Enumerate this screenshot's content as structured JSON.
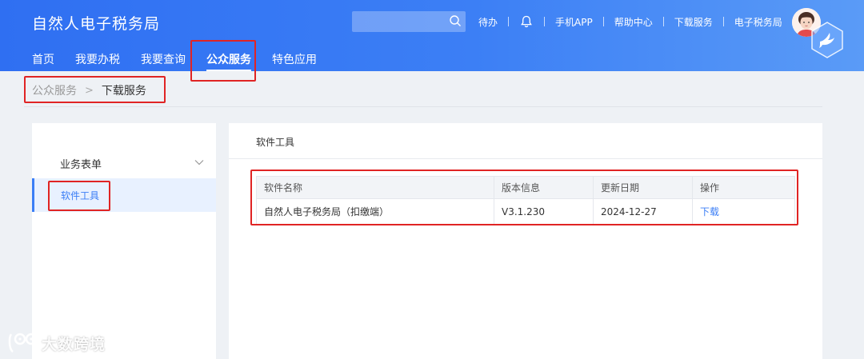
{
  "header": {
    "app_title": "自然人电子税务局",
    "search": {
      "placeholder": ""
    },
    "links": [
      "待办",
      "手机APP",
      "帮助中心",
      "下载服务",
      "电子税务局"
    ]
  },
  "nav": {
    "tabs": [
      {
        "label": "首页",
        "active": false
      },
      {
        "label": "我要办税",
        "active": false
      },
      {
        "label": "我要查询",
        "active": false
      },
      {
        "label": "公众服务",
        "active": true
      },
      {
        "label": "特色应用",
        "active": false
      }
    ]
  },
  "breadcrumb": {
    "parent": "公众服务",
    "separator": ">",
    "current": "下载服务"
  },
  "sidebar": {
    "group_label": "业务表单",
    "selected_item": "软件工具"
  },
  "main": {
    "section_title": "软件工具",
    "table": {
      "headers": [
        "软件名称",
        "版本信息",
        "更新日期",
        "操作"
      ],
      "rows": [
        {
          "name": "自然人电子税务局（扣缴端）",
          "version": "V3.1.230",
          "date": "2024-12-27",
          "action": "下载"
        }
      ]
    }
  },
  "watermark": {
    "text": "大数跨境"
  },
  "colors": {
    "header_blue": "#2f6ff2",
    "accent": "#3b7ef6",
    "annotation_red": "#e02424"
  }
}
